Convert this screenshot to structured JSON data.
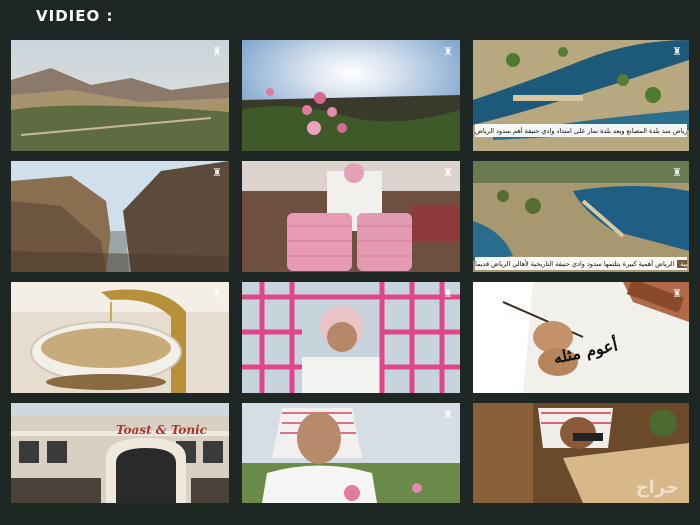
{
  "page": {
    "title": "VIDIEO :"
  },
  "thumbs": [
    {
      "name": "video-thumb-desert-valley"
    },
    {
      "name": "video-thumb-roses-sunrise"
    },
    {
      "name": "video-thumb-aerial-canal",
      "caption": "الرياض  سد بلدة المصانع ويعد بلدة نمار على امتداد وادي حنيفة أهم سدود الرياض"
    },
    {
      "name": "video-thumb-canyon"
    },
    {
      "name": "video-thumb-rose-baskets"
    },
    {
      "name": "video-thumb-aerial-dam",
      "caption": "الرياض  أهمية كبيرة يتلتمها سدود وادي حنيفة التاريخية لأهالي الرياض قديما"
    },
    {
      "name": "video-thumb-pouring-drink"
    },
    {
      "name": "video-thumb-pink-crate"
    },
    {
      "name": "video-thumb-calligraphy"
    },
    {
      "name": "video-thumb-toast-tonic",
      "sign": "Toast & Tonic"
    },
    {
      "name": "video-thumb-elderly-man-rose"
    },
    {
      "name": "video-thumb-craftsman",
      "watermark": "حراج"
    }
  ],
  "caption_tag": "العربية",
  "calligraphy_text": "أعوم مثله"
}
